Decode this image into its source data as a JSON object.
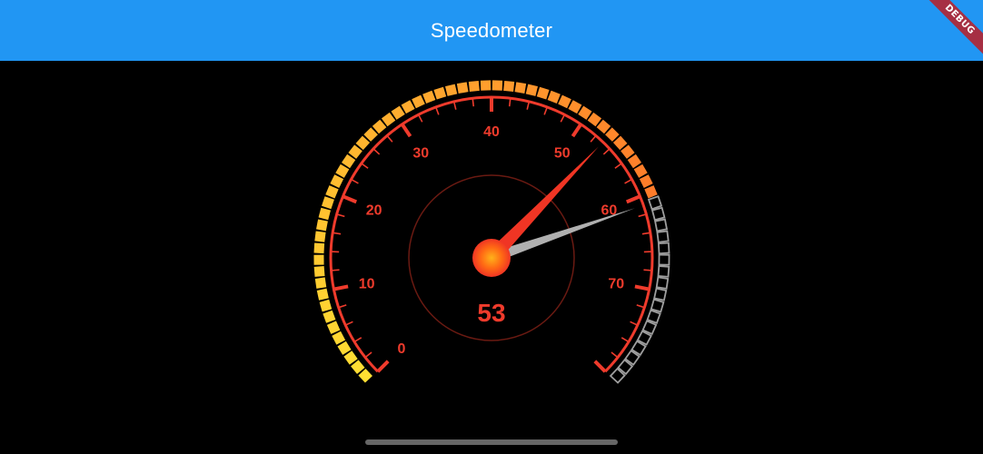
{
  "app_bar": {
    "title": "Speedometer",
    "color": "#2196f3"
  },
  "debug_banner": {
    "label": "DEBUG",
    "color": "#a62f43"
  },
  "speedometer": {
    "min": 0,
    "max": 80,
    "major_step": 10,
    "tick_labels": [
      "0",
      "10",
      "20",
      "30",
      "40",
      "50",
      "60",
      "70"
    ],
    "current_speed": 53,
    "readout": "53",
    "reference_speed": 61,
    "colors": {
      "accent": "#ef3b2c",
      "needle": "#f03524",
      "reference_needle": "#b0b0b0",
      "hub": "#ff5a14",
      "segment_low": "#ffe033",
      "segment_high": "#ff7a2a",
      "segment_inactive": "#9e9e9e"
    }
  }
}
